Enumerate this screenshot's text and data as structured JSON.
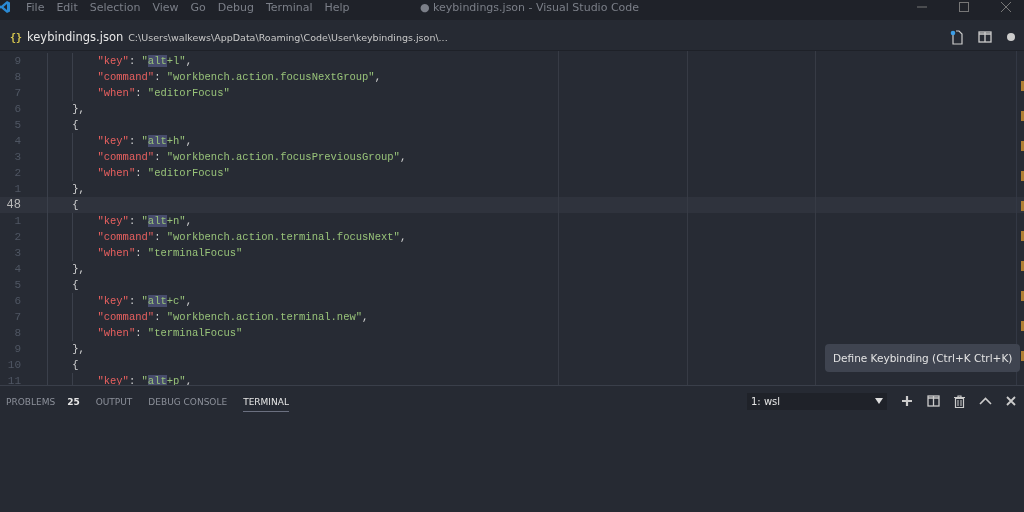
{
  "window": {
    "title": "● keybindings.json - Visual Studio Code",
    "menu": [
      "File",
      "Edit",
      "Selection",
      "View",
      "Go",
      "Debug",
      "Terminal",
      "Help"
    ]
  },
  "tab": {
    "title": "keybindings.json",
    "icon_text": "{}",
    "path": "C:\\Users\\walkews\\AppData\\Roaming\\Code\\User\\keybindings.json\\...",
    "dirty": true
  },
  "editor": {
    "lines": [
      {
        "number": "9",
        "current": false,
        "tokens": [
          {
            "kind": "guide"
          },
          {
            "kind": "guide"
          },
          {
            "kind": "key",
            "text": "\"key\""
          },
          {
            "kind": "punct",
            "text": ": "
          },
          {
            "kind": "string",
            "text": "\""
          },
          {
            "kind": "match",
            "text": "alt"
          },
          {
            "kind": "string",
            "text": "+l\""
          },
          {
            "kind": "punct",
            "text": ","
          }
        ]
      },
      {
        "number": "8",
        "current": false,
        "tokens": [
          {
            "kind": "guide"
          },
          {
            "kind": "guide"
          },
          {
            "kind": "key",
            "text": "\"command\""
          },
          {
            "kind": "punct",
            "text": ": "
          },
          {
            "kind": "string",
            "text": "\"workbench.action.focusNextGroup\""
          },
          {
            "kind": "punct",
            "text": ","
          }
        ]
      },
      {
        "number": "7",
        "current": false,
        "tokens": [
          {
            "kind": "guide"
          },
          {
            "kind": "guide"
          },
          {
            "kind": "key",
            "text": "\"when\""
          },
          {
            "kind": "punct",
            "text": ": "
          },
          {
            "kind": "string",
            "text": "\"editorFocus\""
          }
        ]
      },
      {
        "number": "6",
        "current": false,
        "tokens": [
          {
            "kind": "guide"
          },
          {
            "kind": "punct",
            "text": "},"
          }
        ]
      },
      {
        "number": "5",
        "current": false,
        "tokens": [
          {
            "kind": "guide"
          },
          {
            "kind": "punct",
            "text": "{"
          }
        ]
      },
      {
        "number": "4",
        "current": false,
        "tokens": [
          {
            "kind": "guide"
          },
          {
            "kind": "guide"
          },
          {
            "kind": "key",
            "text": "\"key\""
          },
          {
            "kind": "punct",
            "text": ": "
          },
          {
            "kind": "string",
            "text": "\""
          },
          {
            "kind": "match",
            "text": "alt"
          },
          {
            "kind": "string",
            "text": "+h\""
          },
          {
            "kind": "punct",
            "text": ","
          }
        ]
      },
      {
        "number": "3",
        "current": false,
        "tokens": [
          {
            "kind": "guide"
          },
          {
            "kind": "guide"
          },
          {
            "kind": "key",
            "text": "\"command\""
          },
          {
            "kind": "punct",
            "text": ": "
          },
          {
            "kind": "string",
            "text": "\"workbench.action.focusPreviousGroup\""
          },
          {
            "kind": "punct",
            "text": ","
          }
        ]
      },
      {
        "number": "2",
        "current": false,
        "tokens": [
          {
            "kind": "guide"
          },
          {
            "kind": "guide"
          },
          {
            "kind": "key",
            "text": "\"when\""
          },
          {
            "kind": "punct",
            "text": ": "
          },
          {
            "kind": "string",
            "text": "\"editorFocus\""
          }
        ]
      },
      {
        "number": "1",
        "current": false,
        "tokens": [
          {
            "kind": "guide"
          },
          {
            "kind": "punct",
            "text": "},"
          }
        ]
      },
      {
        "number": "48",
        "current": true,
        "tokens": [
          {
            "kind": "guide"
          },
          {
            "kind": "punct",
            "text": "{"
          }
        ]
      },
      {
        "number": "1",
        "current": false,
        "tokens": [
          {
            "kind": "guide"
          },
          {
            "kind": "guide"
          },
          {
            "kind": "key",
            "text": "\"key\""
          },
          {
            "kind": "punct",
            "text": ": "
          },
          {
            "kind": "string",
            "text": "\""
          },
          {
            "kind": "match",
            "text": "alt"
          },
          {
            "kind": "string",
            "text": "+n\""
          },
          {
            "kind": "punct",
            "text": ","
          }
        ]
      },
      {
        "number": "2",
        "current": false,
        "tokens": [
          {
            "kind": "guide"
          },
          {
            "kind": "guide"
          },
          {
            "kind": "key",
            "text": "\"command\""
          },
          {
            "kind": "punct",
            "text": ": "
          },
          {
            "kind": "string",
            "text": "\"workbench.action.terminal.focusNext\""
          },
          {
            "kind": "punct",
            "text": ","
          }
        ]
      },
      {
        "number": "3",
        "current": false,
        "tokens": [
          {
            "kind": "guide"
          },
          {
            "kind": "guide"
          },
          {
            "kind": "key",
            "text": "\"when\""
          },
          {
            "kind": "punct",
            "text": ": "
          },
          {
            "kind": "string",
            "text": "\"terminalFocus\""
          }
        ]
      },
      {
        "number": "4",
        "current": false,
        "tokens": [
          {
            "kind": "guide"
          },
          {
            "kind": "punct",
            "text": "},"
          }
        ]
      },
      {
        "number": "5",
        "current": false,
        "tokens": [
          {
            "kind": "guide"
          },
          {
            "kind": "punct",
            "text": "{"
          }
        ]
      },
      {
        "number": "6",
        "current": false,
        "tokens": [
          {
            "kind": "guide"
          },
          {
            "kind": "guide"
          },
          {
            "kind": "key",
            "text": "\"key\""
          },
          {
            "kind": "punct",
            "text": ": "
          },
          {
            "kind": "string",
            "text": "\""
          },
          {
            "kind": "match",
            "text": "alt"
          },
          {
            "kind": "string",
            "text": "+c\""
          },
          {
            "kind": "punct",
            "text": ","
          }
        ]
      },
      {
        "number": "7",
        "current": false,
        "tokens": [
          {
            "kind": "guide"
          },
          {
            "kind": "guide"
          },
          {
            "kind": "key",
            "text": "\"command\""
          },
          {
            "kind": "punct",
            "text": ": "
          },
          {
            "kind": "string",
            "text": "\"workbench.action.terminal.new\""
          },
          {
            "kind": "punct",
            "text": ","
          }
        ]
      },
      {
        "number": "8",
        "current": false,
        "tokens": [
          {
            "kind": "guide"
          },
          {
            "kind": "guide"
          },
          {
            "kind": "key",
            "text": "\"when\""
          },
          {
            "kind": "punct",
            "text": ": "
          },
          {
            "kind": "string",
            "text": "\"terminalFocus\""
          }
        ]
      },
      {
        "number": "9",
        "current": false,
        "tokens": [
          {
            "kind": "guide"
          },
          {
            "kind": "punct",
            "text": "},"
          }
        ]
      },
      {
        "number": "10",
        "current": false,
        "tokens": [
          {
            "kind": "guide"
          },
          {
            "kind": "punct",
            "text": "{"
          }
        ]
      },
      {
        "number": "11",
        "current": false,
        "tokens": [
          {
            "kind": "guide"
          },
          {
            "kind": "guide"
          },
          {
            "kind": "key",
            "text": "\"key\""
          },
          {
            "kind": "punct",
            "text": ": "
          },
          {
            "kind": "string",
            "text": "\""
          },
          {
            "kind": "match",
            "text": "alt"
          },
          {
            "kind": "string",
            "text": "+p\""
          },
          {
            "kind": "punct",
            "text": ","
          }
        ]
      }
    ]
  },
  "tooltip": {
    "text": "Define Keybinding (Ctrl+K Ctrl+K)"
  },
  "panel": {
    "tabs": [
      {
        "label": "PROBLEMS",
        "badge": "25",
        "selected": false
      },
      {
        "label": "OUTPUT",
        "selected": false
      },
      {
        "label": "DEBUG CONSOLE",
        "selected": false
      },
      {
        "label": "TERMINAL",
        "selected": true
      }
    ],
    "terminal_select": {
      "value": "1: wsl"
    }
  }
}
